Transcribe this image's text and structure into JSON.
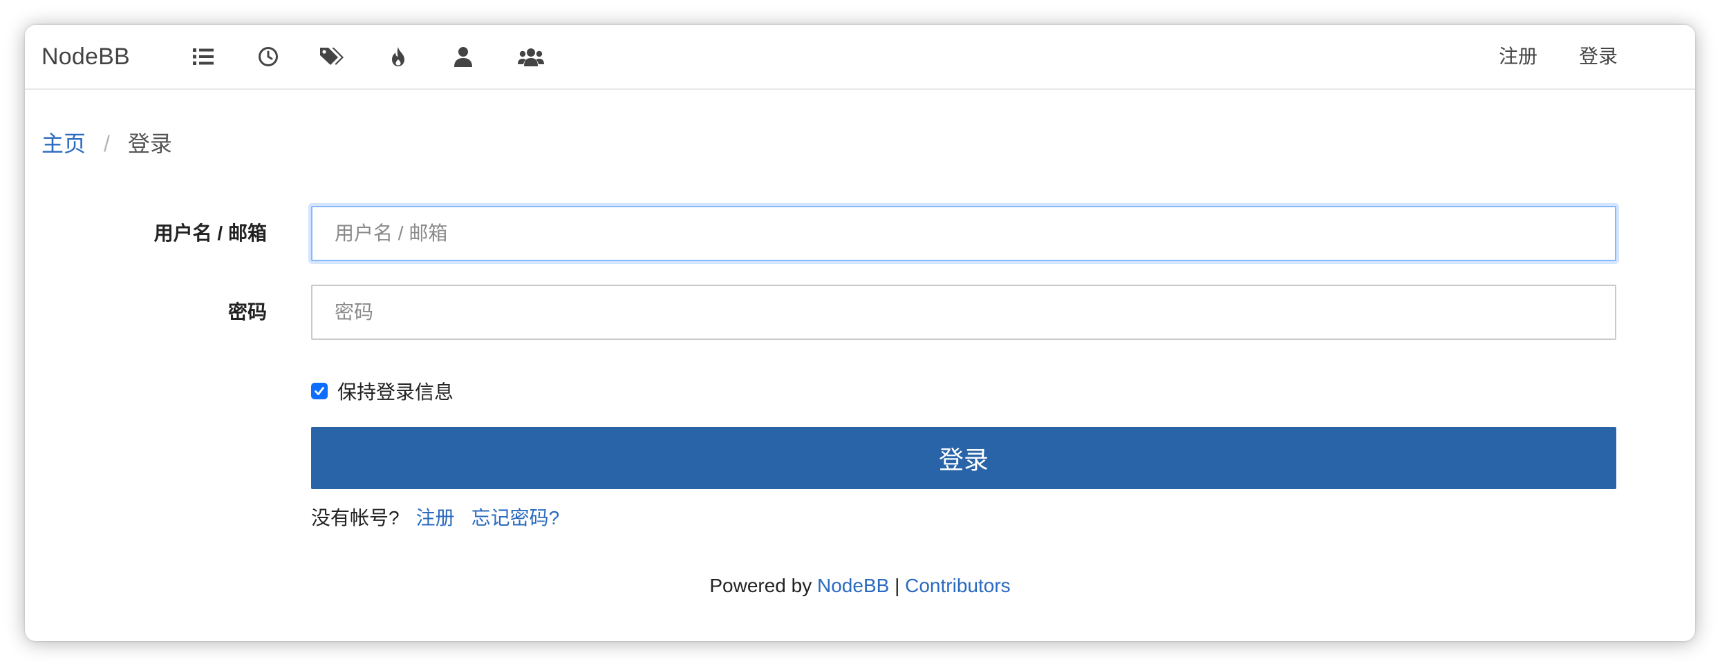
{
  "navbar": {
    "brand": "NodeBB",
    "icons": [
      {
        "name": "categories-list-icon"
      },
      {
        "name": "recent-clock-icon"
      },
      {
        "name": "tags-icon"
      },
      {
        "name": "popular-fire-icon"
      },
      {
        "name": "users-icon"
      },
      {
        "name": "groups-icon"
      }
    ],
    "register_label": "注册",
    "login_label": "登录"
  },
  "breadcrumb": {
    "home": "主页",
    "separator": "/",
    "current": "登录"
  },
  "form": {
    "username_label": "用户名 / 邮箱",
    "username_placeholder": "用户名 / 邮箱",
    "username_value": "",
    "password_label": "密码",
    "password_placeholder": "密码",
    "password_value": "",
    "remember_label": "保持登录信息",
    "remember_checked": true,
    "submit_label": "登录"
  },
  "signup": {
    "prompt": "没有帐号?",
    "register_link": "注册",
    "forgot_link": "忘记密码?"
  },
  "footer": {
    "powered_by": "Powered by",
    "nodebb_link": "NodeBB",
    "separator": "|",
    "contributors_link": "Contributors"
  },
  "colors": {
    "link": "#2a6ac0",
    "primary_button": "#2964a9",
    "checkbox": "#0d6efd",
    "focus_border": "#86b7fe"
  }
}
